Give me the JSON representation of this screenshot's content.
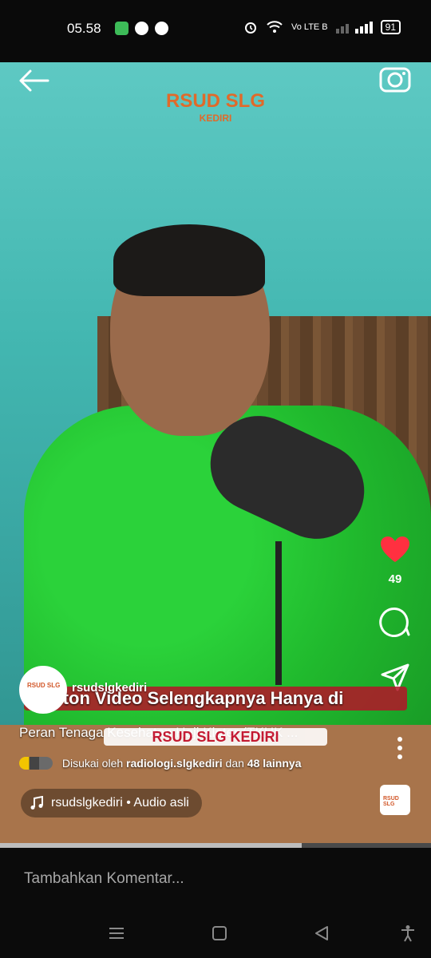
{
  "status_bar": {
    "time": "05.58",
    "apps": [
      "messages-icon",
      "location-icon",
      "tiktok-icon"
    ],
    "network_label": "Vo LTE B",
    "battery": "91",
    "icons": [
      "alarm-icon",
      "wifi-icon",
      "signal-icon",
      "battery-icon"
    ]
  },
  "video": {
    "watermark_title": "RSUD SLG",
    "watermark_subtitle": "KEDIRI",
    "banner_text": "Tonton Video Selengkapnya Hanya di",
    "youtube_banner_text": "RSUD SLG KEDIRI"
  },
  "post": {
    "username": "rsudslgkediri",
    "caption": "Peran Tenaga Kesehatan Haji Kloter (TKHK ...",
    "liked_prefix": "Disukai oleh",
    "liked_user": "radiologi.slgkediri",
    "liked_middle": "dan",
    "liked_others": "48 lainnya",
    "audio": "rsudslgkediri • Audio asli",
    "like_count": "49",
    "profile_logo": "RSUD SLG",
    "audio_thumb_logo": "RSUD SLG"
  },
  "progress": {
    "fraction": 0.7
  },
  "comment": {
    "placeholder": "Tambahkan Komentar..."
  },
  "colors": {
    "heart": "#ff3040",
    "accent_orange": "#e06a2a"
  }
}
